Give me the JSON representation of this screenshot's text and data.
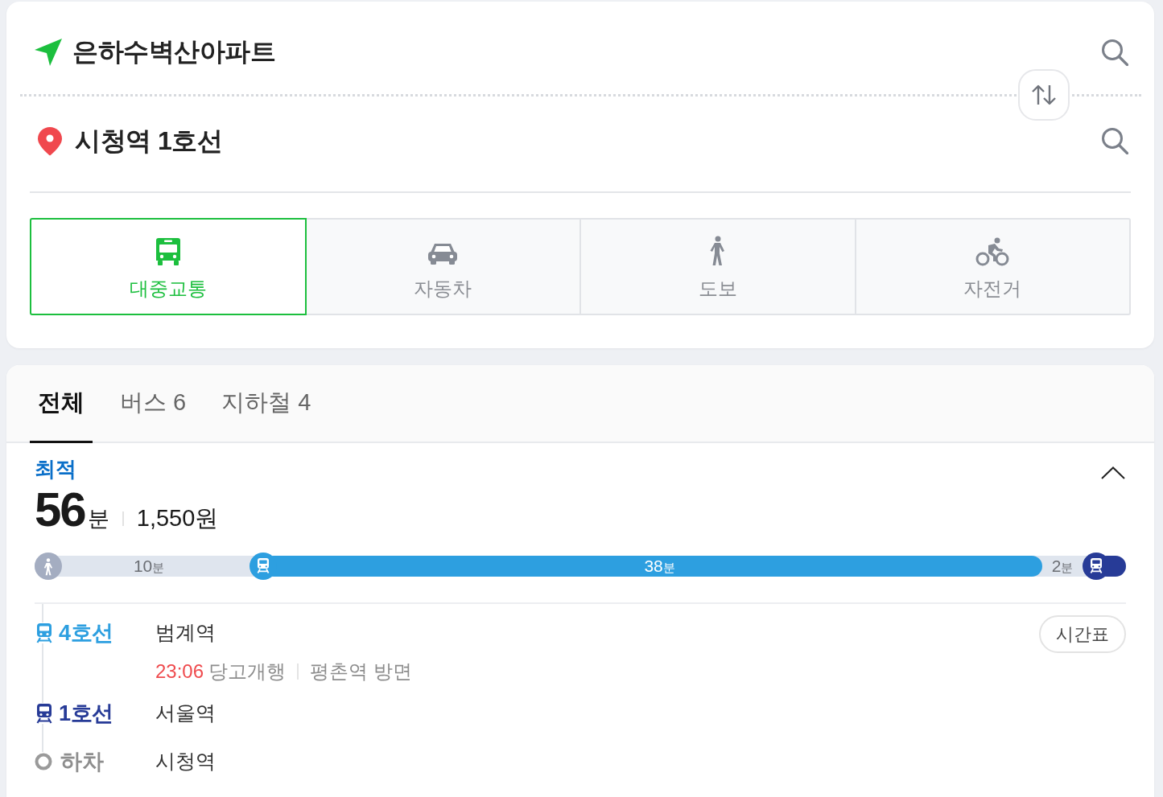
{
  "route_search": {
    "origin": {
      "value": "은하수벽산아파트"
    },
    "destination": {
      "value": "시청역 1호선"
    },
    "modes": [
      {
        "kind": "transit",
        "label": "대중교통",
        "selected": true
      },
      {
        "kind": "car",
        "label": "자동차",
        "selected": false
      },
      {
        "kind": "walk",
        "label": "도보",
        "selected": false
      },
      {
        "kind": "bicycle",
        "label": "자전거",
        "selected": false
      }
    ]
  },
  "results": {
    "tabs": [
      {
        "label": "전체",
        "selected": true
      },
      {
        "label": "버스 6",
        "selected": false
      },
      {
        "label": "지하철 4",
        "selected": false
      }
    ],
    "route": {
      "badge": "최적",
      "expanded": true,
      "duration": {
        "value": "56",
        "unit": "분"
      },
      "fare": "1,550원",
      "timeline": {
        "segments": [
          {
            "kind": "walk",
            "icon": true,
            "duration": {
              "value": "10",
              "unit": "분"
            }
          },
          {
            "kind": "subway",
            "color": "#2d9fe0",
            "icon": true,
            "duration": {
              "value": "38",
              "unit": "분"
            }
          },
          {
            "kind": "walk",
            "icon": false,
            "duration": {
              "value": "2",
              "unit": "분"
            }
          },
          {
            "kind": "subway",
            "color": "#273b97",
            "icon": true
          }
        ]
      },
      "steps": [
        {
          "kind": "subway",
          "color": "#2d9fe0",
          "label": "4호선",
          "station": "범계역",
          "action": "시간표",
          "departure": {
            "time": "23:06",
            "destination": "당고개행",
            "direction": "평촌역 방면"
          }
        },
        {
          "kind": "subway",
          "color": "#273b97",
          "label": "1호선",
          "station": "서울역"
        },
        {
          "kind": "alight",
          "label": "하차",
          "station": "시청역"
        }
      ]
    }
  }
}
